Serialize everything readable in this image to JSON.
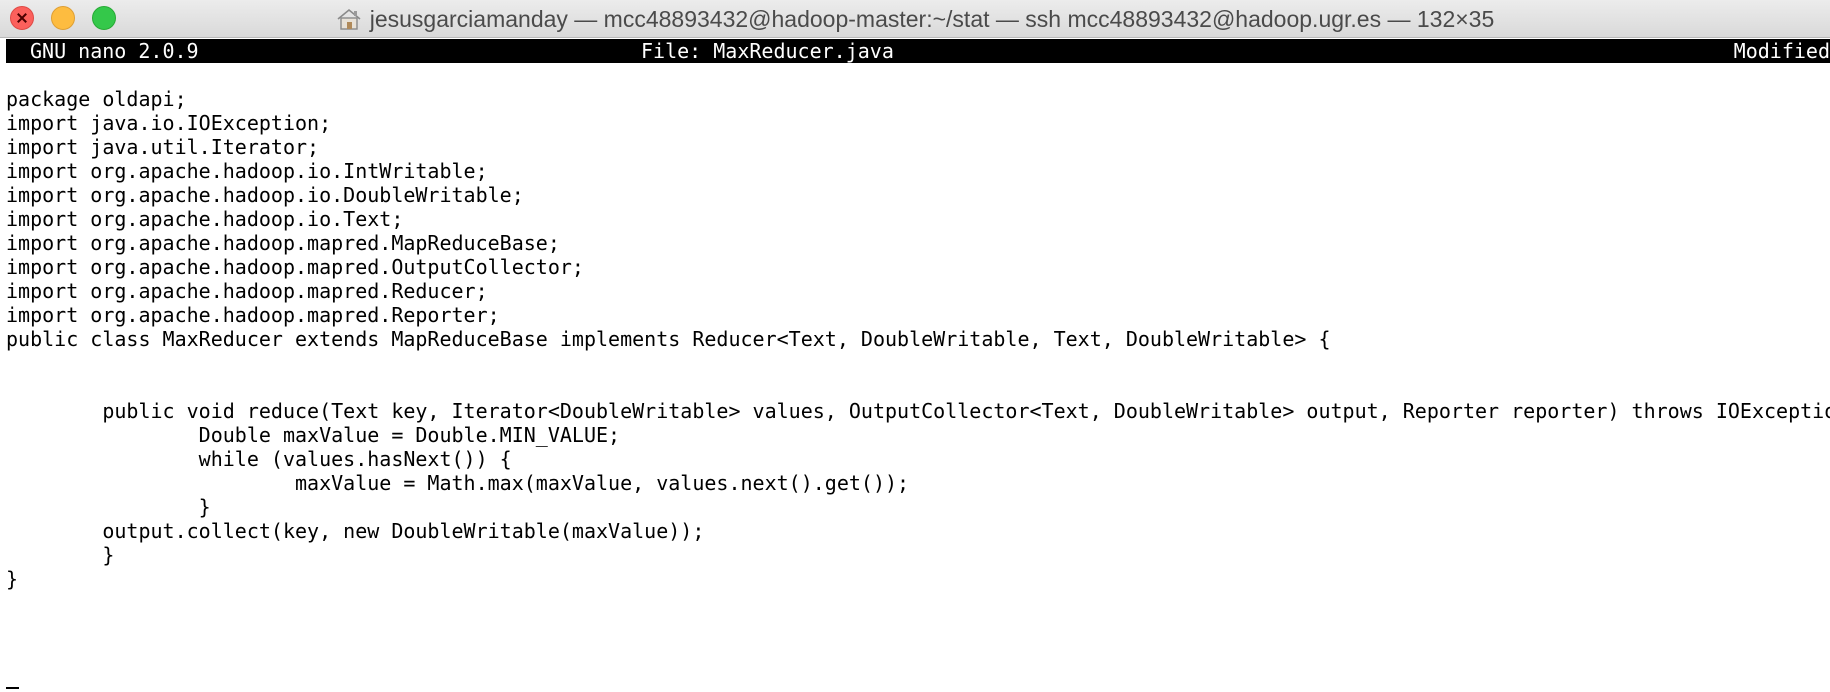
{
  "window": {
    "title": "jesusgarciamanday — mcc48893432@hadoop-master:~/stat — ssh mcc48893432@hadoop.ugr.es — 132×35",
    "title_icon": "home-icon"
  },
  "nano": {
    "version": "GNU nano 2.0.9",
    "file": "File: MaxReducer.java",
    "status": "Modified"
  },
  "code": {
    "lines": [
      "package oldapi;",
      "import java.io.IOException;",
      "import java.util.Iterator;",
      "import org.apache.hadoop.io.IntWritable;",
      "import org.apache.hadoop.io.DoubleWritable;",
      "import org.apache.hadoop.io.Text;",
      "import org.apache.hadoop.mapred.MapReduceBase;",
      "import org.apache.hadoop.mapred.OutputCollector;",
      "import org.apache.hadoop.mapred.Reducer;",
      "import org.apache.hadoop.mapred.Reporter;",
      "public class MaxReducer extends MapReduceBase implements Reducer<Text, DoubleWritable, Text, DoubleWritable> {",
      "",
      "",
      "        public void reduce(Text key, Iterator<DoubleWritable> values, OutputCollector<Text, DoubleWritable> output, Reporter reporter) throws IOException {",
      "                Double maxValue = Double.MIN_VALUE;",
      "                while (values.hasNext()) {",
      "                        maxValue = Math.max(maxValue, values.next().get());",
      "                }",
      "        output.collect(key, new DoubleWritable(maxValue));",
      "        }",
      "}"
    ]
  }
}
